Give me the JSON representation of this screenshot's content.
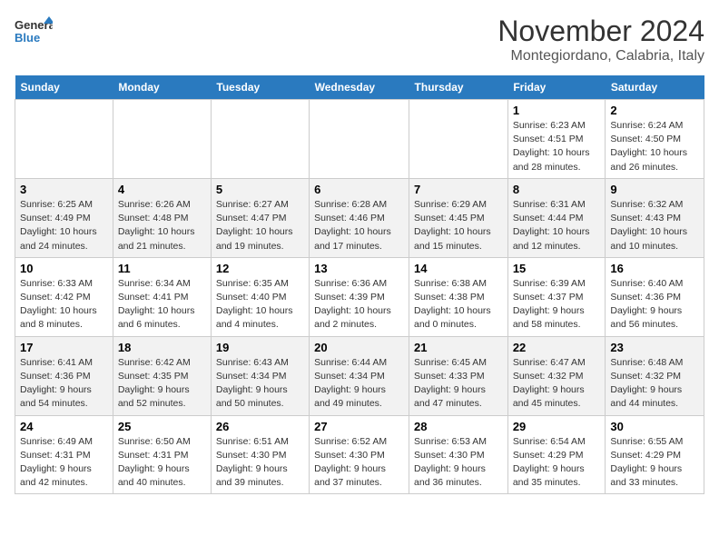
{
  "logo": {
    "line1": "General",
    "line2": "Blue",
    "icon_color": "#2a7abf"
  },
  "title": {
    "month": "November 2024",
    "location": "Montegiordano, Calabria, Italy"
  },
  "weekdays": [
    "Sunday",
    "Monday",
    "Tuesday",
    "Wednesday",
    "Thursday",
    "Friday",
    "Saturday"
  ],
  "weeks": [
    [
      {
        "day": "",
        "info": ""
      },
      {
        "day": "",
        "info": ""
      },
      {
        "day": "",
        "info": ""
      },
      {
        "day": "",
        "info": ""
      },
      {
        "day": "",
        "info": ""
      },
      {
        "day": "1",
        "info": "Sunrise: 6:23 AM\nSunset: 4:51 PM\nDaylight: 10 hours\nand 28 minutes."
      },
      {
        "day": "2",
        "info": "Sunrise: 6:24 AM\nSunset: 4:50 PM\nDaylight: 10 hours\nand 26 minutes."
      }
    ],
    [
      {
        "day": "3",
        "info": "Sunrise: 6:25 AM\nSunset: 4:49 PM\nDaylight: 10 hours\nand 24 minutes."
      },
      {
        "day": "4",
        "info": "Sunrise: 6:26 AM\nSunset: 4:48 PM\nDaylight: 10 hours\nand 21 minutes."
      },
      {
        "day": "5",
        "info": "Sunrise: 6:27 AM\nSunset: 4:47 PM\nDaylight: 10 hours\nand 19 minutes."
      },
      {
        "day": "6",
        "info": "Sunrise: 6:28 AM\nSunset: 4:46 PM\nDaylight: 10 hours\nand 17 minutes."
      },
      {
        "day": "7",
        "info": "Sunrise: 6:29 AM\nSunset: 4:45 PM\nDaylight: 10 hours\nand 15 minutes."
      },
      {
        "day": "8",
        "info": "Sunrise: 6:31 AM\nSunset: 4:44 PM\nDaylight: 10 hours\nand 12 minutes."
      },
      {
        "day": "9",
        "info": "Sunrise: 6:32 AM\nSunset: 4:43 PM\nDaylight: 10 hours\nand 10 minutes."
      }
    ],
    [
      {
        "day": "10",
        "info": "Sunrise: 6:33 AM\nSunset: 4:42 PM\nDaylight: 10 hours\nand 8 minutes."
      },
      {
        "day": "11",
        "info": "Sunrise: 6:34 AM\nSunset: 4:41 PM\nDaylight: 10 hours\nand 6 minutes."
      },
      {
        "day": "12",
        "info": "Sunrise: 6:35 AM\nSunset: 4:40 PM\nDaylight: 10 hours\nand 4 minutes."
      },
      {
        "day": "13",
        "info": "Sunrise: 6:36 AM\nSunset: 4:39 PM\nDaylight: 10 hours\nand 2 minutes."
      },
      {
        "day": "14",
        "info": "Sunrise: 6:38 AM\nSunset: 4:38 PM\nDaylight: 10 hours\nand 0 minutes."
      },
      {
        "day": "15",
        "info": "Sunrise: 6:39 AM\nSunset: 4:37 PM\nDaylight: 9 hours\nand 58 minutes."
      },
      {
        "day": "16",
        "info": "Sunrise: 6:40 AM\nSunset: 4:36 PM\nDaylight: 9 hours\nand 56 minutes."
      }
    ],
    [
      {
        "day": "17",
        "info": "Sunrise: 6:41 AM\nSunset: 4:36 PM\nDaylight: 9 hours\nand 54 minutes."
      },
      {
        "day": "18",
        "info": "Sunrise: 6:42 AM\nSunset: 4:35 PM\nDaylight: 9 hours\nand 52 minutes."
      },
      {
        "day": "19",
        "info": "Sunrise: 6:43 AM\nSunset: 4:34 PM\nDaylight: 9 hours\nand 50 minutes."
      },
      {
        "day": "20",
        "info": "Sunrise: 6:44 AM\nSunset: 4:34 PM\nDaylight: 9 hours\nand 49 minutes."
      },
      {
        "day": "21",
        "info": "Sunrise: 6:45 AM\nSunset: 4:33 PM\nDaylight: 9 hours\nand 47 minutes."
      },
      {
        "day": "22",
        "info": "Sunrise: 6:47 AM\nSunset: 4:32 PM\nDaylight: 9 hours\nand 45 minutes."
      },
      {
        "day": "23",
        "info": "Sunrise: 6:48 AM\nSunset: 4:32 PM\nDaylight: 9 hours\nand 44 minutes."
      }
    ],
    [
      {
        "day": "24",
        "info": "Sunrise: 6:49 AM\nSunset: 4:31 PM\nDaylight: 9 hours\nand 42 minutes."
      },
      {
        "day": "25",
        "info": "Sunrise: 6:50 AM\nSunset: 4:31 PM\nDaylight: 9 hours\nand 40 minutes."
      },
      {
        "day": "26",
        "info": "Sunrise: 6:51 AM\nSunset: 4:30 PM\nDaylight: 9 hours\nand 39 minutes."
      },
      {
        "day": "27",
        "info": "Sunrise: 6:52 AM\nSunset: 4:30 PM\nDaylight: 9 hours\nand 37 minutes."
      },
      {
        "day": "28",
        "info": "Sunrise: 6:53 AM\nSunset: 4:30 PM\nDaylight: 9 hours\nand 36 minutes."
      },
      {
        "day": "29",
        "info": "Sunrise: 6:54 AM\nSunset: 4:29 PM\nDaylight: 9 hours\nand 35 minutes."
      },
      {
        "day": "30",
        "info": "Sunrise: 6:55 AM\nSunset: 4:29 PM\nDaylight: 9 hours\nand 33 minutes."
      }
    ]
  ]
}
